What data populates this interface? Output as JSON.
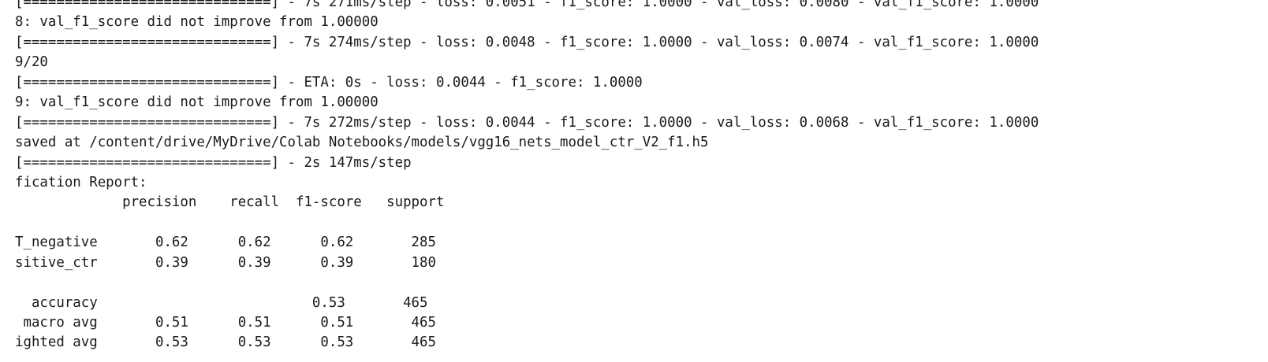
{
  "output": {
    "lines": [
      "[==============================] - 7s 271ms/step - loss: 0.0051 - f1_score: 1.0000 - val_loss: 0.0080 - val_f1_score: 1.0000",
      "8: val_f1_score did not improve from 1.00000",
      "[==============================] - 7s 274ms/step - loss: 0.0048 - f1_score: 1.0000 - val_loss: 0.0074 - val_f1_score: 1.0000",
      "9/20",
      "[==============================] - ETA: 0s - loss: 0.0044 - f1_score: 1.0000",
      "9: val_f1_score did not improve from 1.00000",
      "[==============================] - 7s 272ms/step - loss: 0.0044 - f1_score: 1.0000 - val_loss: 0.0068 - val_f1_score: 1.0000",
      "saved at /content/drive/MyDrive/Colab Notebooks/models/vgg16_nets_model_ctr_V2_f1.h5",
      "[==============================] - 2s 147ms/step",
      "fication Report:",
      "             precision    recall  f1-score   support",
      "",
      "T_negative       0.62      0.62      0.62       285",
      "sitive_ctr       0.39      0.39      0.39       180",
      "",
      "  accuracy                          0.53       465",
      " macro avg       0.51      0.51      0.51       465",
      "ighted avg       0.53      0.53      0.53       465"
    ]
  }
}
